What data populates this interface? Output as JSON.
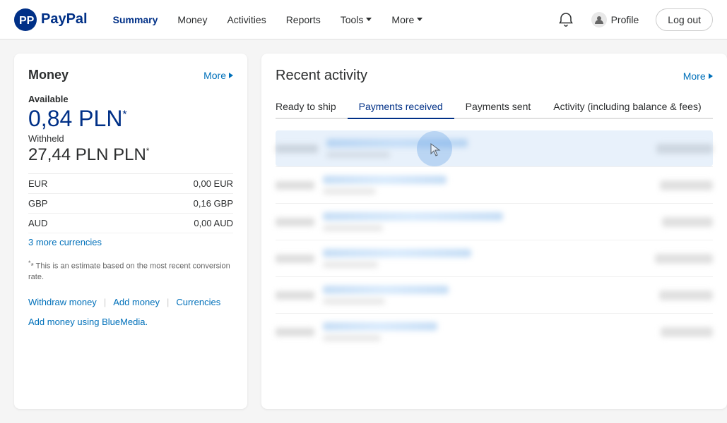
{
  "header": {
    "logo_alt": "PayPal",
    "nav": [
      {
        "label": "Summary",
        "active": true,
        "has_dropdown": false
      },
      {
        "label": "Money",
        "active": false,
        "has_dropdown": false
      },
      {
        "label": "Activities",
        "active": false,
        "has_dropdown": false
      },
      {
        "label": "Reports",
        "active": false,
        "has_dropdown": false
      },
      {
        "label": "Tools",
        "active": false,
        "has_dropdown": true
      },
      {
        "label": "More",
        "active": false,
        "has_dropdown": true
      }
    ],
    "profile_label": "Profile",
    "logout_label": "Log out"
  },
  "money": {
    "title": "Money",
    "more_label": "More",
    "available_label": "Available",
    "balance": "0,84 PLN",
    "balance_asterisk": "*",
    "withheld_label": "Withheld",
    "withheld_amount": "27,44 PLN PLN",
    "withheld_asterisk": "*",
    "currencies": [
      {
        "code": "EUR",
        "value": "0,00 EUR"
      },
      {
        "code": "GBP",
        "value": "0,16 GBP"
      },
      {
        "code": "AUD",
        "value": "0,00 AUD"
      }
    ],
    "more_currencies": "3 more currencies",
    "disclaimer": "* This is an estimate based on the most recent conversion rate.",
    "actions": [
      {
        "label": "Withdraw money"
      },
      {
        "label": "Add money"
      },
      {
        "label": "Currencies"
      }
    ],
    "bluemedia_label": "Add money using BlueMedia."
  },
  "activity": {
    "title": "Recent activity",
    "more_label": "More",
    "tabs": [
      {
        "label": "Ready to ship",
        "active": false
      },
      {
        "label": "Payments received",
        "active": true
      },
      {
        "label": "Payments sent",
        "active": false
      },
      {
        "label": "Activity (including balance & fees)",
        "active": false
      }
    ],
    "rows": [
      {
        "date": "—",
        "name_width": 180,
        "sub_width": 90,
        "amount_width": 78
      },
      {
        "date": "—",
        "name_width": 160,
        "sub_width": 80,
        "amount_width": 75
      },
      {
        "date": "—",
        "name_width": 250,
        "sub_width": 85,
        "amount_width": 72
      },
      {
        "date": "—",
        "name_width": 200,
        "sub_width": 78,
        "amount_width": 80
      },
      {
        "date": "—",
        "name_width": 170,
        "sub_width": 90,
        "amount_width": 76
      },
      {
        "date": "—",
        "name_width": 155,
        "sub_width": 82,
        "amount_width": 74
      }
    ]
  }
}
